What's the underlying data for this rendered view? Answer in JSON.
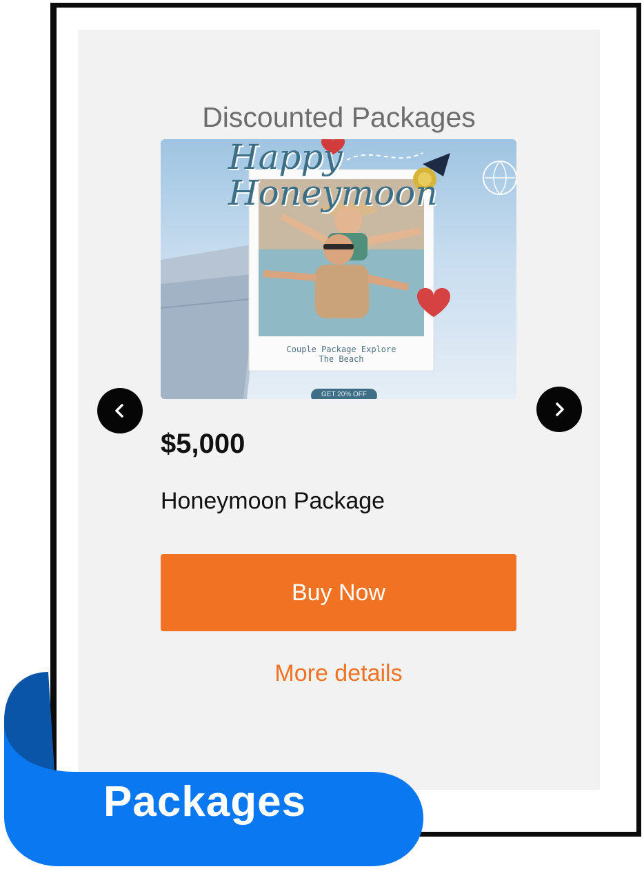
{
  "section": {
    "title": "Discounted Packages"
  },
  "promo": {
    "heading": "Happy\nHoneymoon",
    "caption": "Couple Package Explore\nThe Beach",
    "badge": "GET 20% OFF"
  },
  "product": {
    "price": "$5,000",
    "name": "Honeymoon Package",
    "buy_label": "Buy Now",
    "details_label": "More details"
  },
  "carousel": {
    "prev_icon": "chevron-left-icon",
    "next_icon": "chevron-right-icon"
  },
  "ribbon": {
    "label": "Packages"
  },
  "colors": {
    "accent": "#f07222",
    "ribbon_blue": "#0a78f0",
    "ribbon_shadow": "#0a55a8",
    "card_bg": "#f2f2f2"
  }
}
